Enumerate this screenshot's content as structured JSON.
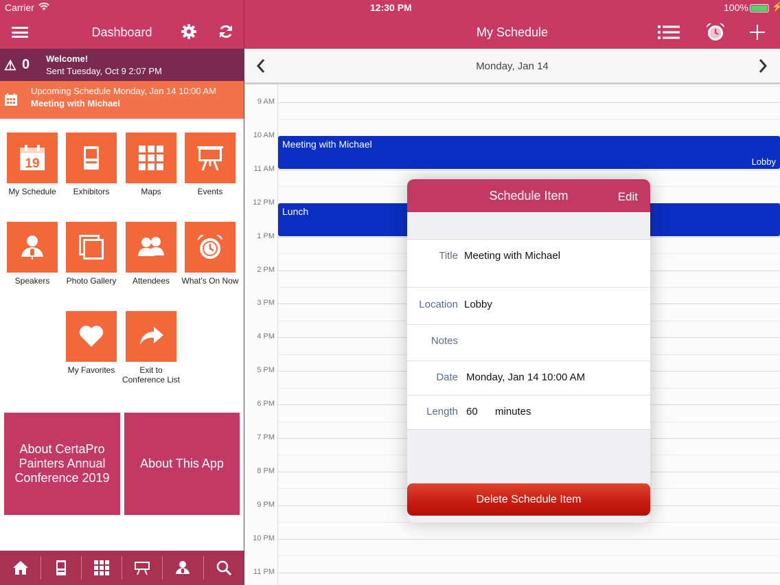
{
  "status_bar": {
    "carrier": "Carrier",
    "time": "12:30 PM",
    "battery": "100%"
  },
  "left_header": {
    "title": "Dashboard"
  },
  "right_header": {
    "title": "My Schedule"
  },
  "welcome": {
    "count": "0",
    "title": "Welcome!",
    "subtitle": "Sent Tuesday, Oct 9 2:07 PM"
  },
  "upcoming": {
    "line1": "Upcoming Schedule Monday, Jan 14 10:00 AM",
    "line2": "Meeting with Michael"
  },
  "tiles": [
    {
      "label": "My Schedule",
      "icon": "calendar-icon",
      "day": "19"
    },
    {
      "label": "Exhibitors",
      "icon": "booth-icon"
    },
    {
      "label": "Maps",
      "icon": "grid-map-icon"
    },
    {
      "label": "Events",
      "icon": "easel-icon"
    },
    {
      "label": "Speakers",
      "icon": "speaker-icon"
    },
    {
      "label": "Photo Gallery",
      "icon": "photos-icon"
    },
    {
      "label": "Attendees",
      "icon": "people-icon"
    },
    {
      "label": "What's On Now",
      "icon": "alarm-clock-icon"
    },
    {
      "label": "My Favorites",
      "icon": "heart-icon"
    },
    {
      "label": "Exit to Conference List",
      "icon": "share-arrow-icon"
    }
  ],
  "big_tiles": [
    {
      "label": "About CertaPro Painters Annual Conference 2019"
    },
    {
      "label": "About This App"
    }
  ],
  "tabbar": [
    {
      "icon": "home-icon"
    },
    {
      "icon": "booth-icon"
    },
    {
      "icon": "grid-map-icon"
    },
    {
      "icon": "easel-icon"
    },
    {
      "icon": "speaker-icon"
    },
    {
      "icon": "search-icon"
    }
  ],
  "datebar": {
    "date": "Monday, Jan 14"
  },
  "hours": [
    "9 AM",
    "10 AM",
    "11 AM",
    "12 PM",
    "1 PM",
    "2 PM",
    "3 PM",
    "4 PM",
    "5 PM",
    "6 PM",
    "7 PM",
    "8 PM",
    "9 PM",
    "10 PM",
    "11 PM"
  ],
  "events": [
    {
      "title": "Meeting with Michael",
      "location": "Lobby"
    },
    {
      "title": "Lunch",
      "location": ""
    }
  ],
  "popover": {
    "title": "Schedule Item",
    "edit": "Edit",
    "fields": {
      "title_label": "Title",
      "title_value": "Meeting with Michael",
      "location_label": "Location",
      "location_value": "Lobby",
      "notes_label": "Notes",
      "notes_value": "",
      "date_label": "Date",
      "date_value": "Monday, Jan 14 10:00 AM",
      "length_label": "Length",
      "length_value": "60",
      "length_unit": "minutes"
    },
    "delete": "Delete Schedule Item"
  },
  "colors": {
    "brand": "#c83a62",
    "accent_orange": "#f2683a",
    "event_blue": "#0b2ec3",
    "welcome_bg": "#7a2a4e"
  }
}
